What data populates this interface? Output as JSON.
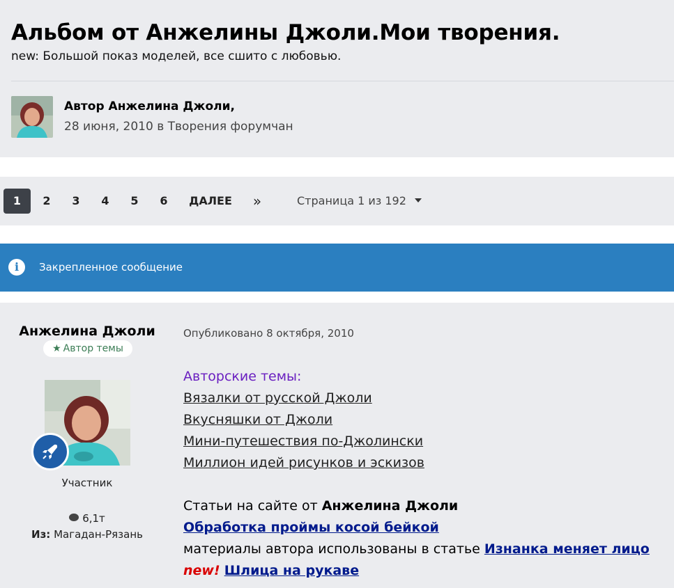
{
  "header": {
    "title": "Альбом от Анжелины Джоли.Мои творения.",
    "description": "new: Большой показ моделей, все сшито с любовью.",
    "author_line": "Автор Анжелина Джоли,",
    "date": "28 июня, 2010",
    "in_word": " в ",
    "forum": "Творения форумчан"
  },
  "pagination": {
    "pages": [
      "1",
      "2",
      "3",
      "4",
      "5",
      "6"
    ],
    "active": "1",
    "next_label": "ДАЛЕЕ",
    "last_label": "»",
    "info": "Страница 1 из 192"
  },
  "pinned": {
    "icon": "info-icon",
    "label": "Закрепленное сообщение"
  },
  "post": {
    "author": "Анжелина Джоли",
    "badge": "Автор темы",
    "role": "Участник",
    "post_count": "6,1т",
    "from_label": "Из:",
    "from_value": "Магадан-Рязань",
    "date": "Опубликовано 8 октября, 2010",
    "heading": "Авторские темы:",
    "topics": [
      "Вязалки от русской Джоли",
      "Вкусняшки от Джоли",
      "Мини-путешествия по-Джолински",
      "Миллион идей рисунков и эскизов"
    ],
    "articles_prefix": "Статьи на сайте от ",
    "articles_author": "Анжелина Джоли",
    "article1": "Обработка проймы косой бейкой",
    "materials_text": "материалы автора использованы в статье ",
    "article2": "Изнанка меняет лицо",
    "new_label": "new!",
    "article3": "Шлица на рукаве"
  },
  "colors": {
    "pinned_bg": "#2b7fc0",
    "active_page_bg": "#3d4148",
    "heading_purple": "#6a1fc0",
    "link_blue": "#001a8c",
    "new_red": "#d90000"
  }
}
